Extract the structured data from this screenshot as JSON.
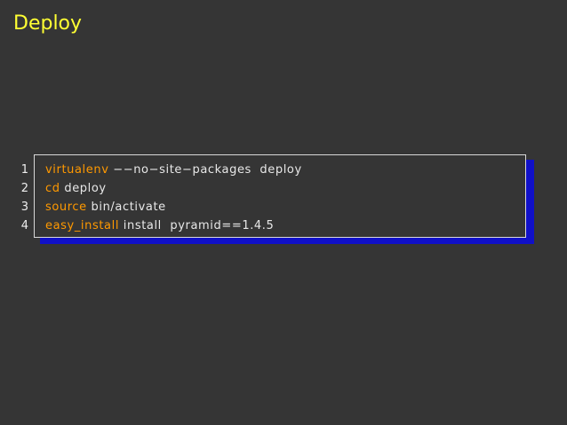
{
  "slide": {
    "title": "Deploy"
  },
  "code": {
    "line_numbers": [
      "1",
      "2",
      "3",
      "4"
    ],
    "lines": [
      {
        "kw": "virtualenv",
        "rest": " −−no−site−packages  deploy"
      },
      {
        "kw": "cd",
        "rest": " deploy"
      },
      {
        "kw": "source",
        "rest": " bin/activate"
      },
      {
        "kw": "easy_install",
        "rest": " install  pyramid==1.4.5"
      }
    ],
    "colors": {
      "keyword": "#ff9900",
      "text": "#e8e8e8",
      "shadow": "#1010c8",
      "title": "#ffff33",
      "background": "#353535"
    }
  }
}
